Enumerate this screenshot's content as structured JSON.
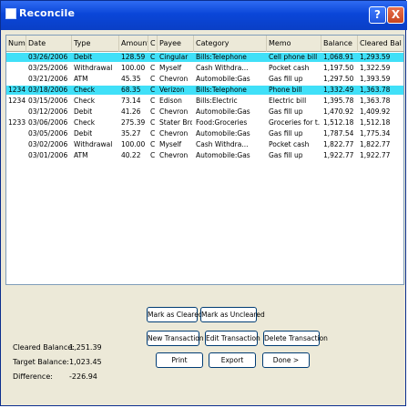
{
  "window": {
    "title": "Reconcile",
    "help_label": "?",
    "close_label": "X"
  },
  "columns": [
    "Num",
    "Date",
    "Type",
    "Amount",
    "C",
    "Payee",
    "Category",
    "Memo",
    "Balance",
    "Cleared Bal"
  ],
  "rows": [
    {
      "num": "",
      "date": "03/26/2006",
      "type": "Debit",
      "amount": "128.59",
      "c": "C",
      "payee": "Cingular",
      "category": "Bills:Telephone",
      "memo": "Cell phone bill",
      "balance": "1,068.91",
      "cleared": "1,293.59",
      "selected": true
    },
    {
      "num": "",
      "date": "03/25/2006",
      "type": "Withdrawal",
      "amount": "100.00",
      "c": "C",
      "payee": "Myself",
      "category": "Cash Withdra...",
      "memo": "Pocket cash",
      "balance": "1,197.50",
      "cleared": "1,322.59",
      "selected": false
    },
    {
      "num": "",
      "date": "03/21/2006",
      "type": "ATM",
      "amount": "45.35",
      "c": "C",
      "payee": "Chevron",
      "category": "Automobile:Gas",
      "memo": "Gas fill up",
      "balance": "1,297.50",
      "cleared": "1,393.59",
      "selected": false
    },
    {
      "num": "1234",
      "date": "03/18/2006",
      "type": "Check",
      "amount": "68.35",
      "c": "C",
      "payee": "Verizon",
      "category": "Bills:Telephone",
      "memo": "Phone bill",
      "balance": "1,332.49",
      "cleared": "1,363.78",
      "selected": true
    },
    {
      "num": "1234",
      "date": "03/15/2006",
      "type": "Check",
      "amount": "73.14",
      "c": "C",
      "payee": "Edison",
      "category": "Bills:Electric",
      "memo": "Electric bill",
      "balance": "1,395.78",
      "cleared": "1,363.78",
      "selected": false
    },
    {
      "num": "",
      "date": "03/12/2006",
      "type": "Debit",
      "amount": "41.26",
      "c": "C",
      "payee": "Chevron",
      "category": "Automobile:Gas",
      "memo": "Gas fill up",
      "balance": "1,470.92",
      "cleared": "1,409.92",
      "selected": false
    },
    {
      "num": "1233",
      "date": "03/06/2006",
      "type": "Check",
      "amount": "275.39",
      "c": "C",
      "payee": "Stater Bros",
      "category": "Food:Groceries",
      "memo": "Groceries for t...",
      "balance": "1,512.18",
      "cleared": "1,512.18",
      "selected": false
    },
    {
      "num": "",
      "date": "03/05/2006",
      "type": "Debit",
      "amount": "35.27",
      "c": "C",
      "payee": "Chevron",
      "category": "Automobile:Gas",
      "memo": "Gas fill up",
      "balance": "1,787.54",
      "cleared": "1,775.34",
      "selected": false
    },
    {
      "num": "",
      "date": "03/02/2006",
      "type": "Withdrawal",
      "amount": "100.00",
      "c": "C",
      "payee": "Myself",
      "category": "Cash Withdra...",
      "memo": "Pocket cash",
      "balance": "1,822.77",
      "cleared": "1,822.77",
      "selected": false
    },
    {
      "num": "",
      "date": "03/01/2006",
      "type": "ATM",
      "amount": "40.22",
      "c": "C",
      "payee": "Chevron",
      "category": "Automobile:Gas",
      "memo": "Gas fill up",
      "balance": "1,922.77",
      "cleared": "1,922.77",
      "selected": false
    }
  ],
  "summary": {
    "cleared_label": "Cleared Balance:",
    "cleared_value": "1,251.39",
    "target_label": "Target Balance:",
    "target_value": "1,023.45",
    "diff_label": "Difference:",
    "diff_value": "-226.94"
  },
  "buttons": {
    "mark_cleared": "Mark as Cleared",
    "mark_uncleared": "Mark as Uncleared",
    "new_transaction": "New Transaction",
    "edit_transaction": "Edit Transaction",
    "delete_transaction": "Delete Transaction",
    "print": "Print",
    "export": "Export",
    "done": "Done >"
  },
  "colors": {
    "selected_row": "#40e0f8",
    "title_bar": "#0a46d8"
  }
}
